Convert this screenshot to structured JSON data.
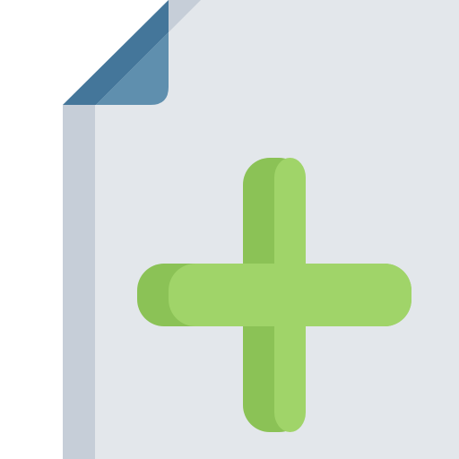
{
  "icon": {
    "name": "new-file-icon",
    "kind": "document-with-plus",
    "colors": {
      "page": "#e3e7eb",
      "page_edge": "#c6ced8",
      "fold": "#5f8fae",
      "fold_shadow": "#44769a",
      "plus": "#a0d469",
      "plus_shadow": "#8bc256"
    }
  }
}
